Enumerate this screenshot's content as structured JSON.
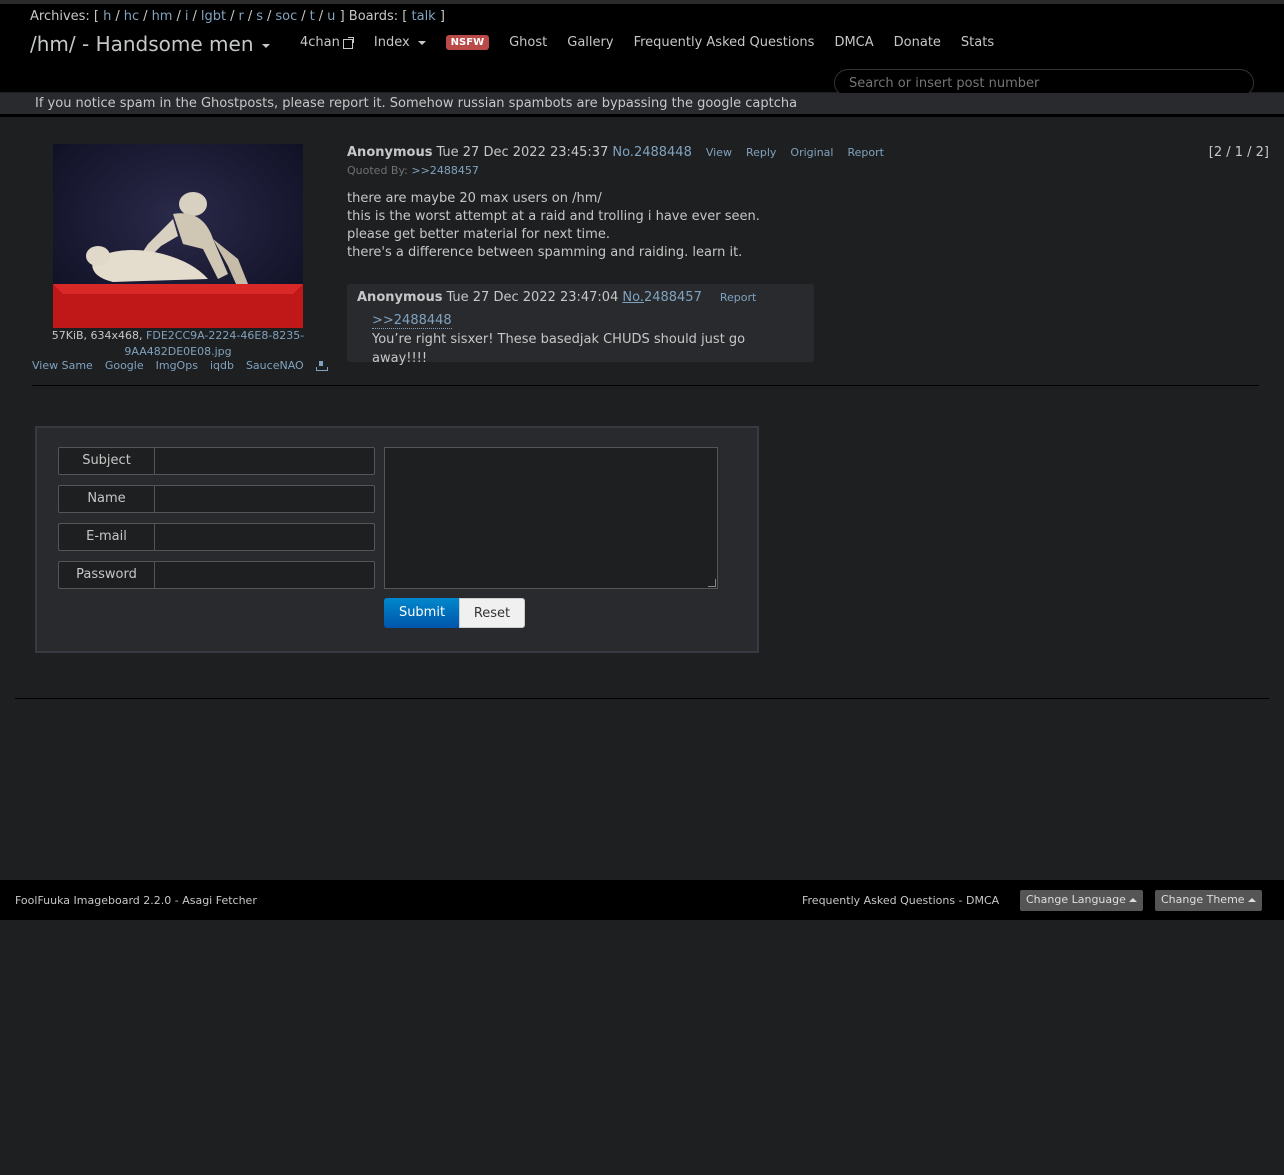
{
  "archives": {
    "label": "Archives: [",
    "boards": [
      "h",
      "hc",
      "hm",
      "i",
      "lgbt",
      "r",
      "s",
      "soc",
      "t",
      "u"
    ],
    "close": "]",
    "boards_label": "Boards: [",
    "board_links": [
      "talk"
    ],
    "boards_close": "]"
  },
  "header": {
    "board_title": "/hm/ - Handsome men",
    "nav": {
      "fourchan": "4chan",
      "index": "Index",
      "nsfw": "NSFW",
      "ghost": "Ghost",
      "gallery": "Gallery",
      "faq": "Frequently Asked Questions",
      "dmca": "DMCA",
      "donate": "Donate",
      "stats": "Stats"
    },
    "search_placeholder": "Search or insert post number"
  },
  "notice": "If you notice spam in the Ghostposts, please report it. Somehow russian spambots are bypassing the google captcha",
  "post": {
    "file_meta": "57KiB, 634x468,",
    "file_name": "FDE2CC9A-2224-46E8-8235-9AA482DE0E08.jpg",
    "file_tools": [
      "View Same",
      "Google",
      "ImgOps",
      "iqdb",
      "SauceNAO"
    ],
    "name": "Anonymous",
    "date": "Tue 27 Dec 2022 23:45:37",
    "number": "No.2488448",
    "actions": [
      "View",
      "Reply",
      "Original",
      "Report"
    ],
    "quoted_by_label": "Quoted By:",
    "quoted_by": ">>2488457",
    "counter": "[2 / 1 / 2]",
    "body": [
      "there are maybe 20 max users on /hm/",
      "this is the worst attempt at a raid and trolling i have ever seen.",
      "please get better material for next time.",
      "there's a difference between spamming and raiding. learn it."
    ]
  },
  "reply": {
    "name": "Anonymous",
    "date": "Tue 27 Dec 2022 23:47:04",
    "no_prefix": "No.",
    "number": "2488457",
    "report": "Report",
    "quote": ">>2488448",
    "text": "You’re right sisxer! These basedjak CHUDS should just go away!!!!"
  },
  "form": {
    "subject_label": "Subject",
    "name_label": "Name",
    "email_label": "E-mail",
    "password_label": "Password",
    "submit": "Submit",
    "reset": "Reset"
  },
  "footer": {
    "left": "FoolFuuka Imageboard 2.2.0 - Asagi Fetcher",
    "right": "Frequently Asked Questions - DMCA",
    "change_language": "Change Language",
    "change_theme": "Change Theme"
  }
}
